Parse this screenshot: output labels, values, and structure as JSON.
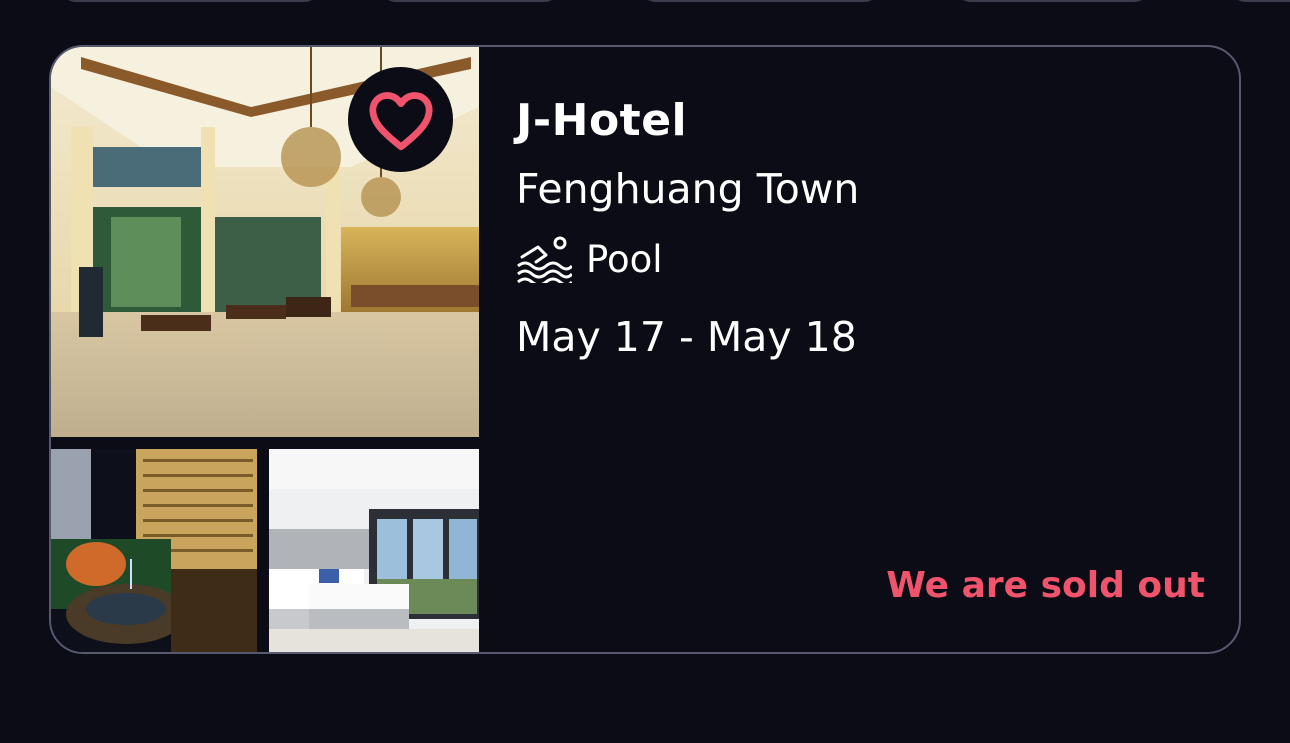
{
  "hotel": {
    "name": "J-Hotel",
    "location": "Fenghuang Town",
    "amenity": {
      "label": "Pool",
      "icon": "swimmer-icon"
    },
    "dates": "May 17 - May 18",
    "status": "We are sold out"
  },
  "gallery": {
    "images": [
      {
        "name": "lobby-photo"
      },
      {
        "name": "night-pool-photo"
      },
      {
        "name": "bedroom-photo"
      }
    ],
    "favorite_icon": "heart-icon"
  },
  "colors": {
    "background": "#0b0c16",
    "card_border": "#575a6e",
    "accent": "#f0546d",
    "text": "#ffffff"
  }
}
